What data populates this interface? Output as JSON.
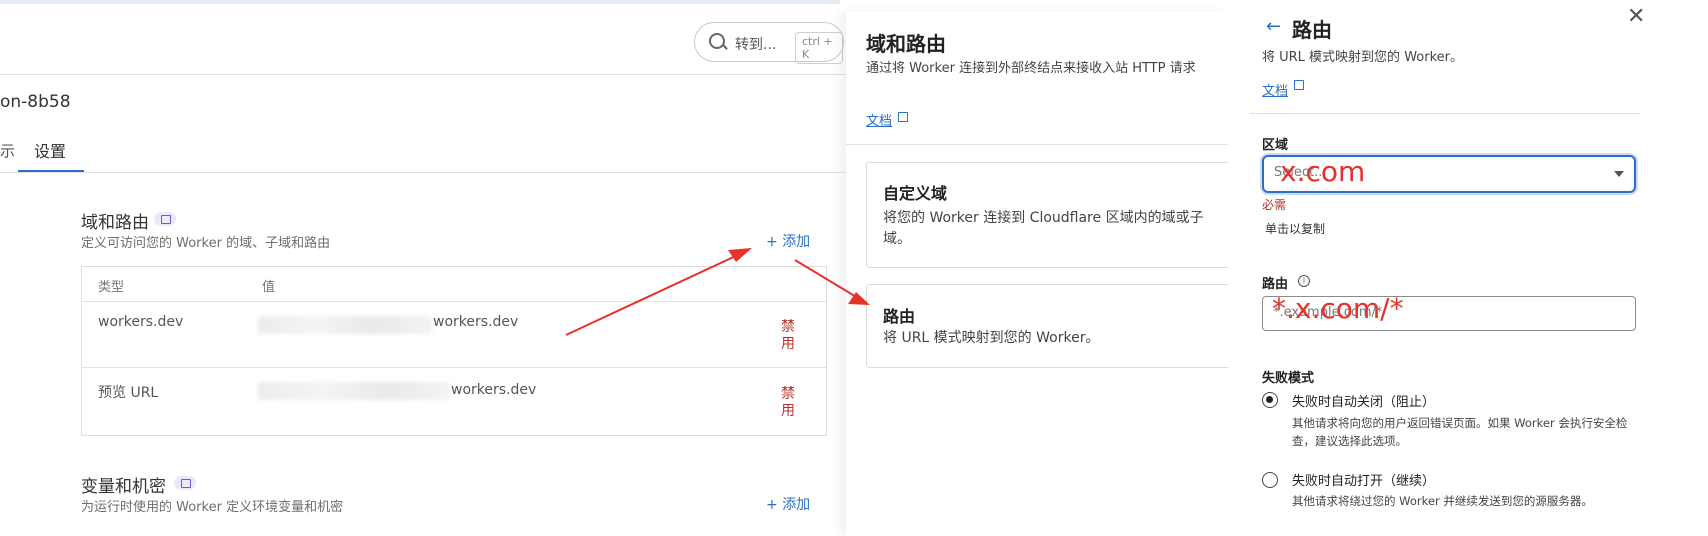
{
  "header": {
    "search_label": "转到...",
    "search_shortcut": "ctrl + K"
  },
  "project": {
    "name_partial": "on-8b58",
    "tab_partial": "示",
    "tab_settings": "设置"
  },
  "domains_section": {
    "title": "域和路由",
    "desc": "定义可访问您的 Worker 的域、子域和路由",
    "add_label": "添加",
    "columns": [
      "类型",
      "值"
    ],
    "rows": [
      {
        "type": "workers.dev",
        "value_suffix": "workers.dev",
        "action": "禁用"
      },
      {
        "type": "预览 URL",
        "value_suffix": "workers.dev",
        "action": "禁用"
      }
    ]
  },
  "vars_section": {
    "title": "变量和机密",
    "desc": "为运行时使用的 Worker 定义环境变量和机密",
    "add_label": "添加"
  },
  "middle_panel": {
    "title": "域和路由",
    "desc": "通过将 Worker 连接到外部终结点来接收入站 HTTP 请求",
    "doc_label": "文档",
    "cards": [
      {
        "title": "自定义域",
        "desc": "将您的 Worker 连接到 Cloudflare 区域内的域或子域。"
      },
      {
        "title": "路由",
        "desc": "将 URL 模式映射到您的 Worker。"
      }
    ]
  },
  "right_panel": {
    "title": "路由",
    "desc": "将 URL 模式映射到您的 Worker。",
    "doc_label": "文档",
    "zone_label": "区域",
    "zone_placeholder": "Select...",
    "zone_overlay": "x.com",
    "required_text": "必需",
    "copy_hint": "单击以复制",
    "route_label": "路由",
    "route_placeholder": "*.example.com/*",
    "route_overlay": "*.x.com/*",
    "failure_label": "失败模式",
    "options": [
      {
        "label": "失败时自动关闭（阻止）",
        "desc": "其他请求将向您的用户返回错误页面。如果 Worker 会执行安全检查，建议选择此选项。",
        "selected": true
      },
      {
        "label": "失败时自动打开（继续）",
        "desc": "其他请求将绕过您的 Worker 并继续发送到您的源服务器。",
        "selected": false
      }
    ]
  },
  "colors": {
    "accent": "#2a6fc9",
    "danger": "#b3342c",
    "annotation_red": "#e8312a"
  }
}
